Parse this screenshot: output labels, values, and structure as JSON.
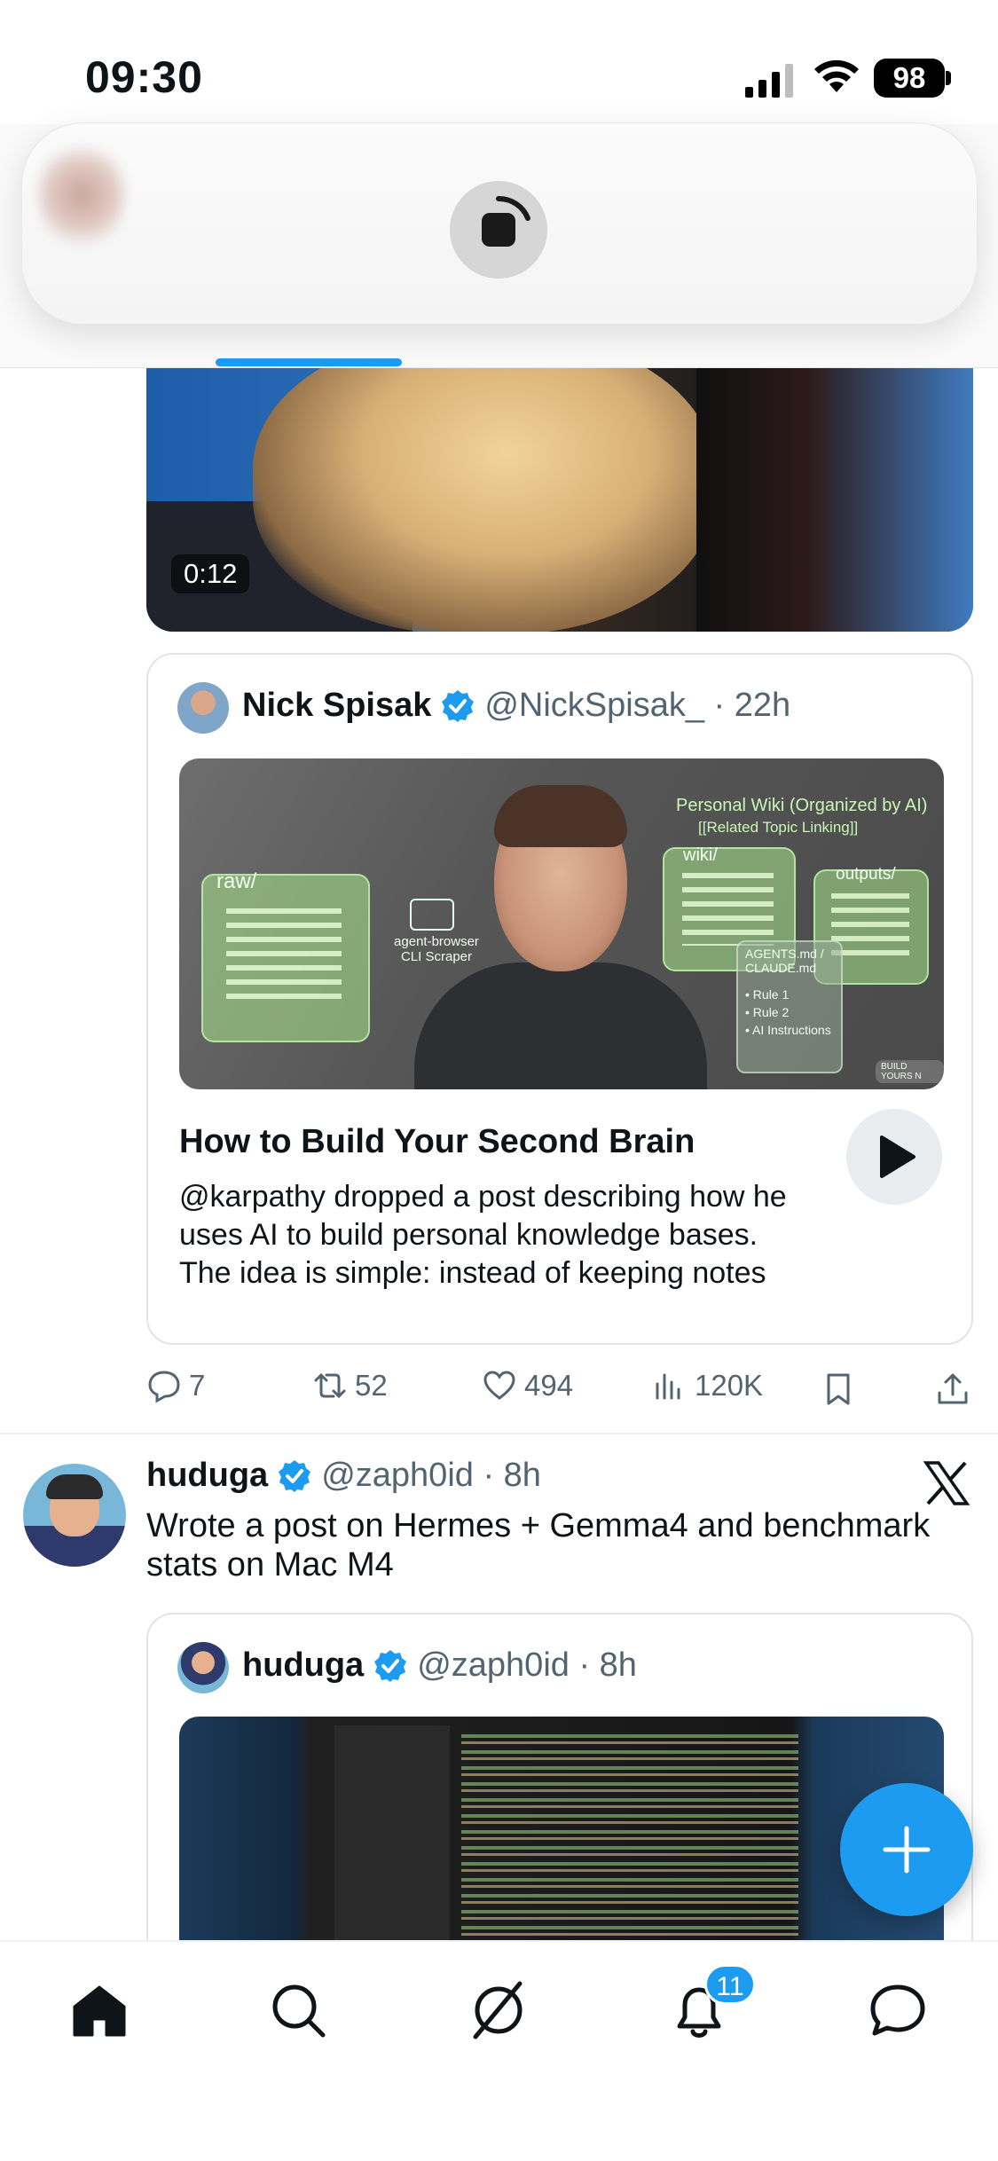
{
  "status_bar": {
    "time": "09:30",
    "battery": "98"
  },
  "video": {
    "duration": "0:12"
  },
  "quoted_post_1": {
    "author_name": "Nick Spisak",
    "handle_time": "@NickSpisak_ · 22h",
    "image_labels": {
      "raw": "raw/",
      "scraper": "agent-browser\nCLI Scraper",
      "wiki_title": "Personal Wiki (Organized by AI)",
      "wiki_sub": "[[Related Topic Linking]]",
      "wiki": "wiki/",
      "outputs": "outputs/",
      "agents": "AGENTS.md / CLAUDE.md",
      "rules": [
        "• Rule 1",
        "• Rule 2",
        "• AI Instructions"
      ],
      "badge": "BUILD YOURS N"
    },
    "article_title": "How to Build Your Second Brain",
    "article_body": "@karpathy  dropped a post describing how he uses AI to build personal knowledge bases.\nThe idea is simple: instead of keeping notes"
  },
  "actions": {
    "replies": "7",
    "reposts": "52",
    "likes": "494",
    "views": "120K"
  },
  "post_2": {
    "author_name": "huduga",
    "handle_time": "@zaph0id · 8h",
    "text": "Wrote a post on Hermes + Gemma4 and benchmark stats on Mac M4"
  },
  "quoted_post_2": {
    "author_name": "huduga",
    "handle_time": "@zaph0id · 8h"
  },
  "nav": {
    "notifications_badge": "11"
  },
  "colors": {
    "accent": "#1d9bf0",
    "text": "#0f1419",
    "muted": "#536471"
  }
}
